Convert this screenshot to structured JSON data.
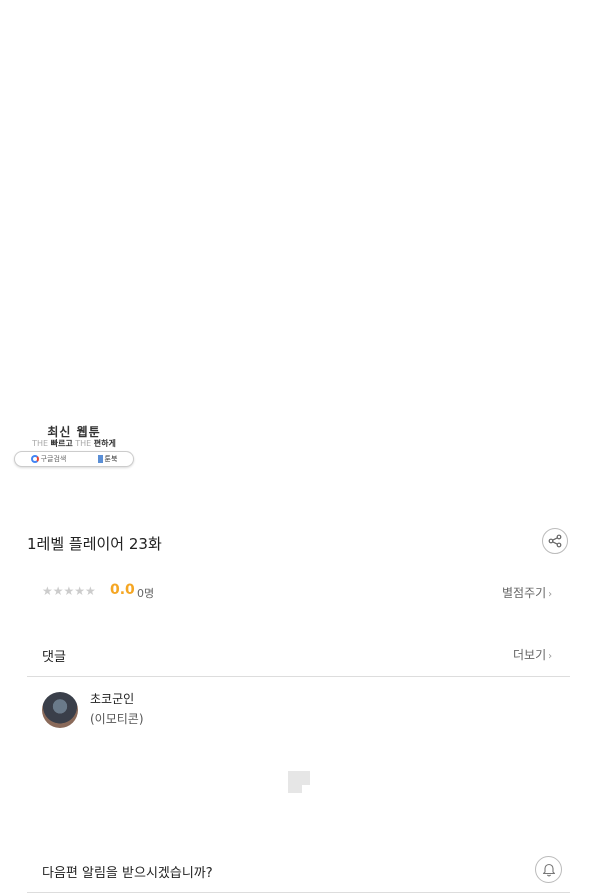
{
  "promo": {
    "title": "최신 웹툰",
    "the1": "THE",
    "fast": "빠르고",
    "the2": "THE",
    "easy": "편하게",
    "google_label": "구글검색",
    "book_label": "툰북"
  },
  "episode": {
    "title": "1레벨 플레이어 23화"
  },
  "rating": {
    "stars": "★★★★★",
    "score": "0.0",
    "count": "0명",
    "rate_label": "별점주기"
  },
  "comments": {
    "heading": "댓글",
    "more_label": "더보기",
    "items": [
      {
        "author": "초코군인",
        "text": "(이모티콘)"
      }
    ]
  },
  "notify": {
    "question": "다음편 알림을 받으시겠습니까?"
  },
  "chevron": "›",
  "colors": {
    "score": "#f5a623",
    "divider": "#dddddd"
  },
  "icons": {
    "share": "share-icon",
    "bell": "bell-icon",
    "google": "google-icon",
    "book": "book-icon"
  }
}
